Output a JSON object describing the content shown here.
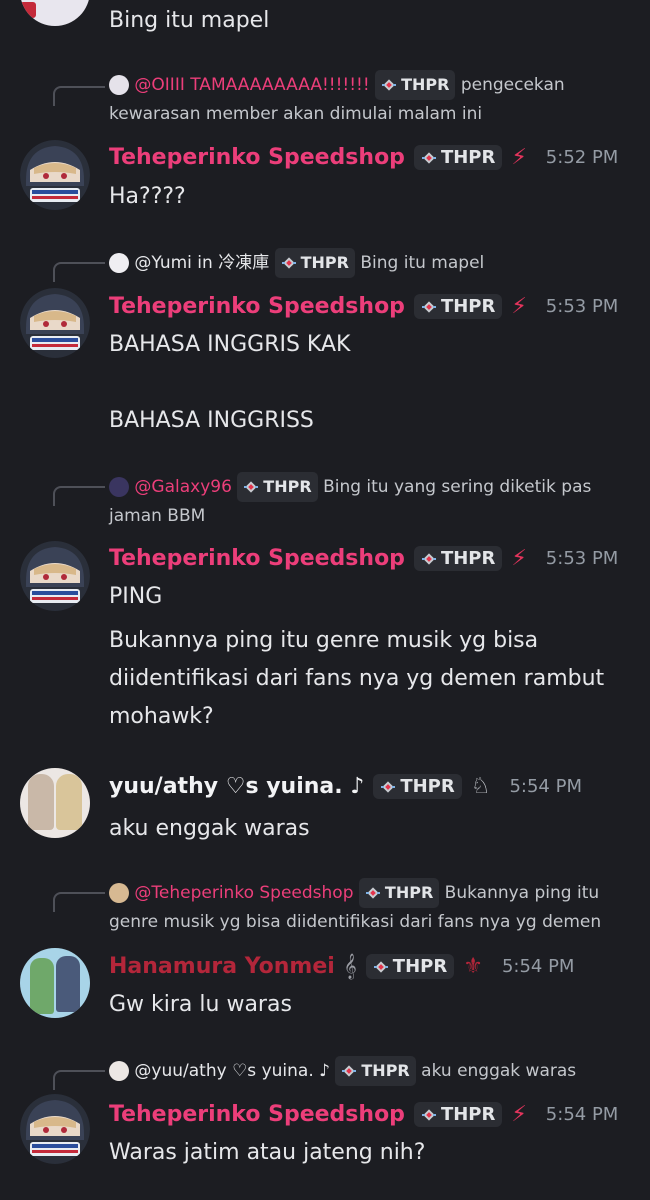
{
  "messages": [
    {
      "text": "Bing itu mapel"
    },
    {
      "reply": {
        "name": "@OIIII TAMAAAAAAAA!!!!!!!",
        "tag": "THPR",
        "text_line1": "pengecekan",
        "text_line2": "kewarasan member akan dimulai malam ini"
      },
      "author": "Teheperinko Speedshop",
      "tag": "THPR",
      "time": "5:52 PM",
      "lines": [
        "Ha????"
      ]
    },
    {
      "reply": {
        "name": "@Yumi in 冷凍庫",
        "tag": "THPR",
        "text_line1": "Bing itu mapel"
      },
      "author": "Teheperinko Speedshop",
      "tag": "THPR",
      "time": "5:53 PM",
      "lines": [
        "BAHASA INGGRIS KAK",
        "BAHASA INGGRISS"
      ]
    },
    {
      "reply": {
        "name": "@Galaxy96",
        "tag": "THPR",
        "text_line1": "Bing itu yang sering diketik pas",
        "text_line2": "jaman BBM"
      },
      "author": "Teheperinko Speedshop",
      "tag": "THPR",
      "time": "5:53 PM",
      "lines": [
        "PING",
        "Bukannya ping itu genre musik yg bisa",
        "diidentifikasi dari fans nya yg demen rambut",
        "mohawk?"
      ]
    },
    {
      "author": "yuu/athy ♡s yuina. ♪",
      "tag": "THPR",
      "time": "5:54 PM",
      "lines": [
        "aku enggak waras"
      ]
    },
    {
      "reply": {
        "name": "@Teheperinko Speedshop",
        "tag": "THPR",
        "text_line1": "Bukannya ping itu",
        "text_line2": "genre musik yg bisa diidentifikasi dari fans nya yg demen"
      },
      "author": "Hanamura Yonmei",
      "tag": "THPR",
      "time": "5:54 PM",
      "lines": [
        "Gw kira lu waras"
      ]
    },
    {
      "reply": {
        "name": "@yuu/athy ♡s yuina. ♪",
        "tag": "THPR",
        "text_line1": "aku enggak waras"
      },
      "author": "Teheperinko Speedshop",
      "tag": "THPR",
      "time": "5:54 PM",
      "lines": [
        "Waras jatim atau jateng nih?"
      ]
    }
  ],
  "colors": {
    "background": "#1c1d22",
    "accent_name": "#ec3e7a",
    "tag_bg": "#2b2d33",
    "time": "#949ba4"
  }
}
